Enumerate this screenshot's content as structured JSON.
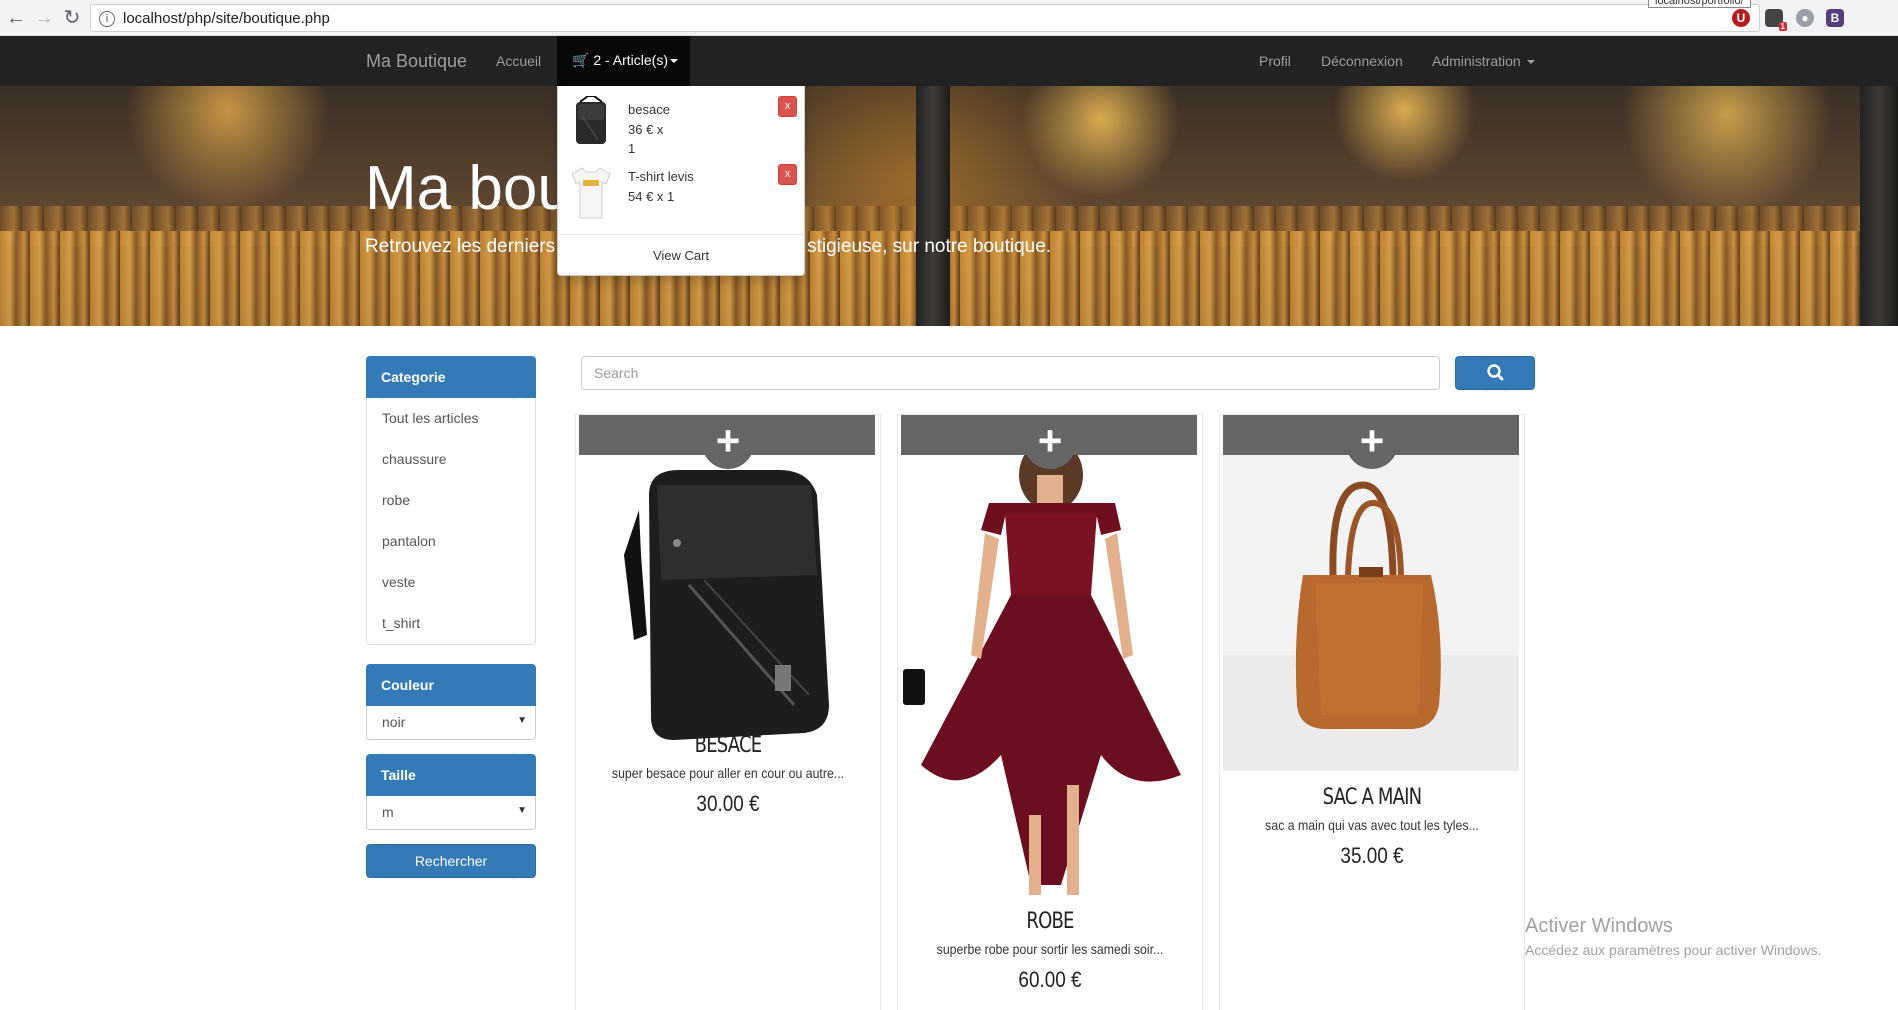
{
  "browser": {
    "url": "localhost/php/site/boutique.php",
    "tooltip": "localhost/portfolio/",
    "extensions": [
      "U",
      "1",
      "B"
    ]
  },
  "navbar": {
    "brand": "Ma Boutique",
    "home": "Accueil",
    "cart_label": "2 - Article(s)",
    "profile": "Profil",
    "logout": "Déconnexion",
    "admin": "Administration"
  },
  "cart": {
    "items": [
      {
        "name": "besace",
        "price_line": "36 €  x",
        "qty_line": "1",
        "remove": "x"
      },
      {
        "name": "T-shirt levis",
        "price_line": "54 €  x 1",
        "qty_line": "",
        "remove": "x"
      }
    ],
    "view_cart": "View Cart"
  },
  "hero": {
    "title": "Ma bou",
    "subtitle": "Retrouvez les derniers articles de la marque prestigieuse, sur notre boutique.",
    "subtitle_left": "Retrouvez les derniers",
    "subtitle_right": "stigieuse, sur notre boutique."
  },
  "sidebar": {
    "category_header": "Categorie",
    "categories": [
      "Tout les articles",
      "chaussure",
      "robe",
      "pantalon",
      "veste",
      "t_shirt"
    ],
    "color_header": "Couleur",
    "color_value": "noir",
    "size_header": "Taille",
    "size_value": "m",
    "search_button": "Rechercher"
  },
  "search": {
    "placeholder": "Search"
  },
  "products": [
    {
      "title": "BESACE",
      "description": "super besace pour aller en cour ou autre...",
      "price": "30.00 €"
    },
    {
      "title": "ROBE",
      "description": "superbe robe pour sortir les samedi soir...",
      "price": "60.00 €"
    },
    {
      "title": "SAC A MAIN",
      "description": "sac a main qui vas avec tout les tyles...",
      "price": "35.00 €"
    }
  ],
  "watermark": {
    "line1": "Activer Windows",
    "line2": "Accédez aux paramètres pour activer Windows."
  },
  "colors": {
    "navbar": "#222222",
    "primary": "#337ab7",
    "danger": "#d9534f",
    "card_bar": "#666666"
  }
}
